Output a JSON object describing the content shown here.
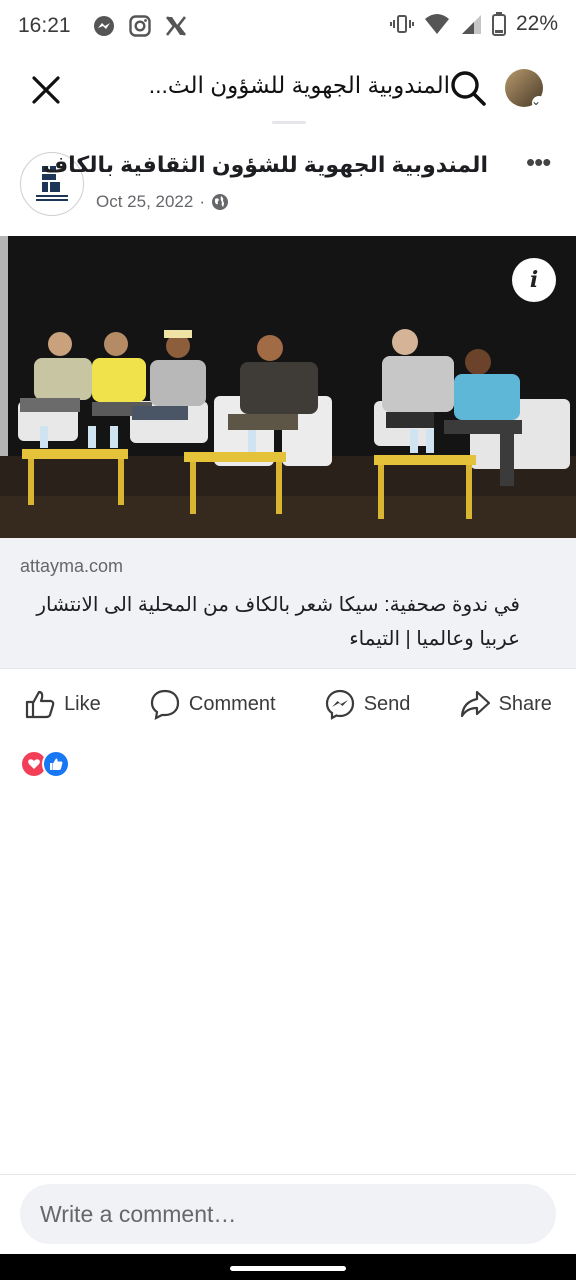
{
  "status": {
    "time": "16:21",
    "battery": "22%",
    "apps": [
      "messenger-icon",
      "instagram-icon",
      "x-icon"
    ],
    "indicators": [
      "vibrate-icon",
      "wifi-icon",
      "signal-icon",
      "battery-icon"
    ]
  },
  "topbar": {
    "search_text": "المندوبية الجهوية للشؤون الث..."
  },
  "post": {
    "page_name": "المندوبية الجهوية للشؤون الثقافية بالكاف",
    "date": "Oct 25, 2022",
    "separator": "·",
    "privacy": "public-globe-icon"
  },
  "link": {
    "domain": "attayma.com",
    "title": "في ندوة صحفية: سيكا شعر بالكاف من المحلية الى الانتشار عربيا وعالميا | التيماء"
  },
  "actions": {
    "like": "Like",
    "comment": "Comment",
    "send": "Send",
    "share": "Share"
  },
  "reactions": [
    "love",
    "like"
  ],
  "comment_box": {
    "placeholder": "Write a comment…"
  },
  "colors": {
    "accent": "#1877f2",
    "love": "#f33e58",
    "muted": "#65676b",
    "panel": "#f0f2f5"
  }
}
